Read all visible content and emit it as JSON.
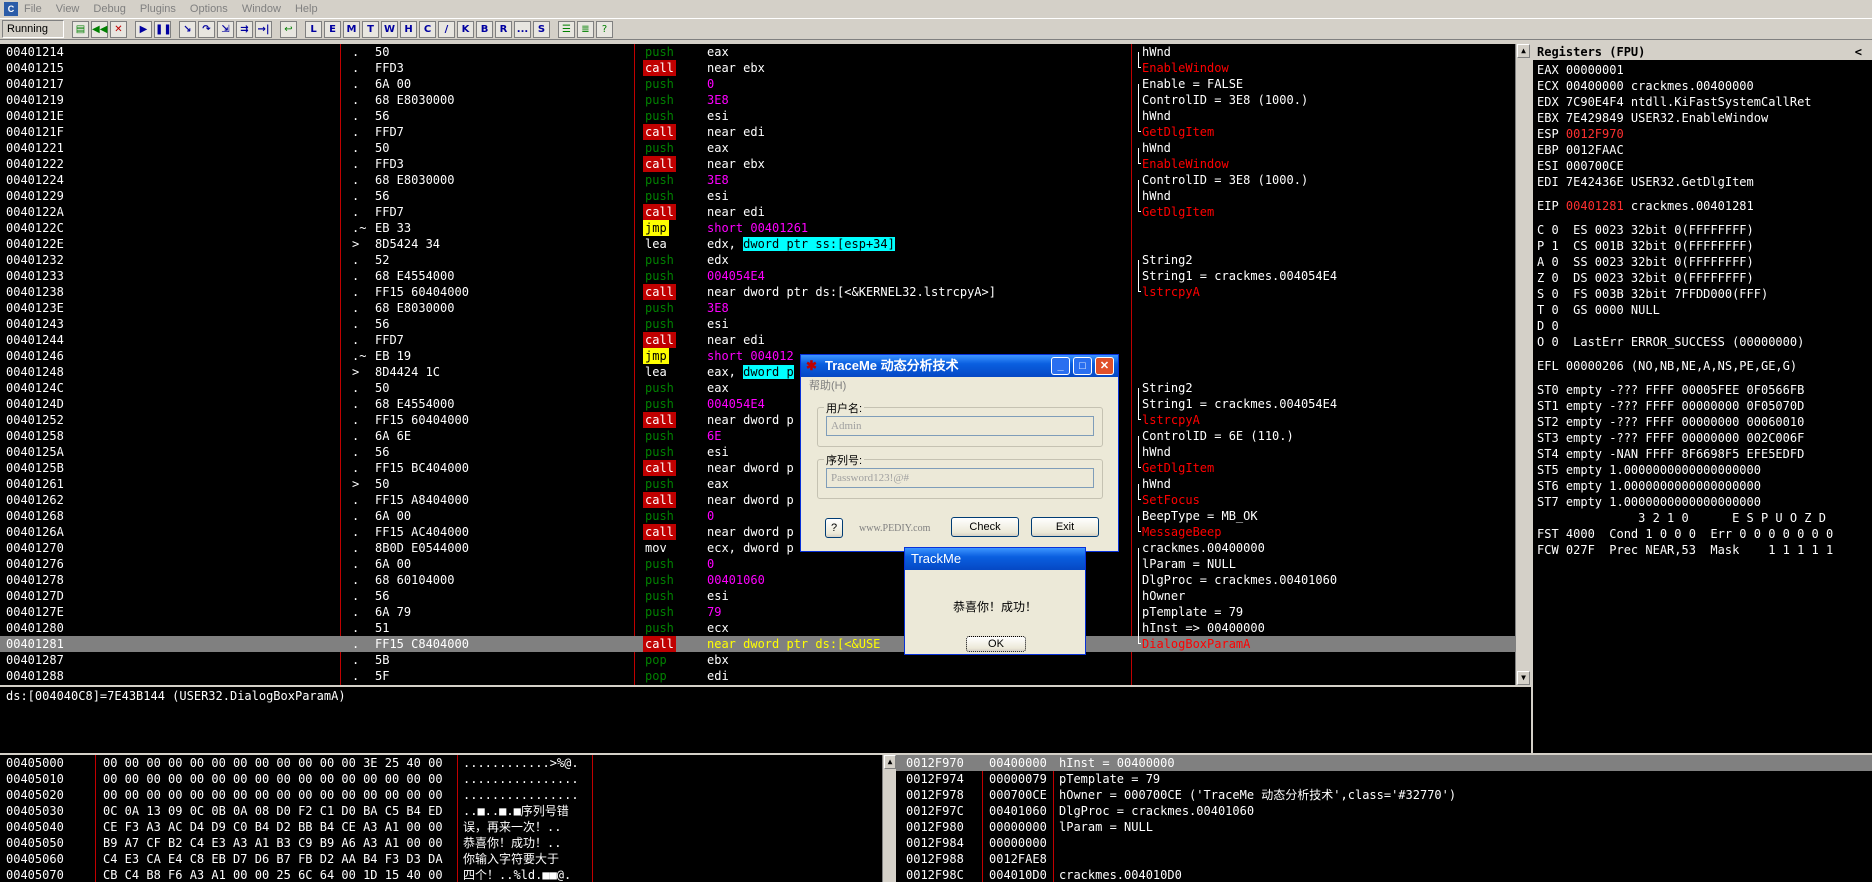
{
  "menubar": [
    "File",
    "View",
    "Debug",
    "Plugins",
    "Options",
    "Window",
    "Help"
  ],
  "toolbar": {
    "status": "Running",
    "buttons": [
      "L",
      "E",
      "M",
      "T",
      "W",
      "H",
      "C",
      "/",
      "K",
      "B",
      "R",
      "...",
      "S"
    ]
  },
  "cpu": [
    {
      "a": "00401214",
      "d": ".",
      "h": "50",
      "m": "push",
      "o": "eax",
      "c": "hWnd",
      "cc": ""
    },
    {
      "a": "00401215",
      "d": ".",
      "h": "FFD3",
      "m": "call",
      "o": "near ebx",
      "c": "EnableWindow",
      "cc": "fn"
    },
    {
      "a": "00401217",
      "d": ".",
      "h": "6A 00",
      "m": "push",
      "o": "0",
      "oc": "num",
      "c": "Enable = FALSE",
      "cc": ""
    },
    {
      "a": "00401219",
      "d": ".",
      "h": "68 E8030000",
      "m": "push",
      "o": "3E8",
      "oc": "num",
      "c": "ControlID = 3E8 (1000.)",
      "cc": ""
    },
    {
      "a": "0040121E",
      "d": ".",
      "h": "56",
      "m": "push",
      "o": "esi",
      "c": "hWnd",
      "cc": ""
    },
    {
      "a": "0040121F",
      "d": ".",
      "h": "FFD7",
      "m": "call",
      "o": "near edi",
      "c": "GetDlgItem",
      "cc": "fn"
    },
    {
      "a": "00401221",
      "d": ".",
      "h": "50",
      "m": "push",
      "o": "eax",
      "c": "hWnd",
      "cc": ""
    },
    {
      "a": "00401222",
      "d": ".",
      "h": "FFD3",
      "m": "call",
      "o": "near ebx",
      "c": "EnableWindow",
      "cc": "fn"
    },
    {
      "a": "00401224",
      "d": ".",
      "h": "68 E8030000",
      "m": "push",
      "o": "3E8",
      "oc": "num",
      "c": "ControlID = 3E8 (1000.)",
      "cc": ""
    },
    {
      "a": "00401229",
      "d": ".",
      "h": "56",
      "m": "push",
      "o": "esi",
      "c": "hWnd",
      "cc": ""
    },
    {
      "a": "0040122A",
      "d": ".",
      "h": "FFD7",
      "m": "call",
      "o": "near edi",
      "c": "GetDlgItem",
      "cc": "fn"
    },
    {
      "a": "0040122C",
      "d": ".~",
      "h": "EB 33",
      "m": "jmp",
      "o": "short 00401261",
      "oc": "num",
      "c": "",
      "cc": ""
    },
    {
      "a": "0040122E",
      "d": ">",
      "h": "8D5424 34",
      "m": "lea",
      "o": "edx, ",
      "o2": "dword ptr ss:[esp+34]",
      "c": "",
      "cc": ""
    },
    {
      "a": "00401232",
      "d": ".",
      "h": "52",
      "m": "push",
      "o": "edx",
      "c": "String2",
      "cc": ""
    },
    {
      "a": "00401233",
      "d": ".",
      "h": "68 E4554000",
      "m": "push",
      "o": "004054E4",
      "oc": "num",
      "c": "String1 = crackmes.004054E4",
      "cc": ""
    },
    {
      "a": "00401238",
      "d": ".",
      "h": "FF15 60404000",
      "m": "call",
      "o": "near dword ptr ds:[<&KERNEL32.lstrcpyA>]",
      "c": "lstrcpyA",
      "cc": "fn"
    },
    {
      "a": "0040123E",
      "d": ".",
      "h": "68 E8030000",
      "m": "push",
      "o": "3E8",
      "oc": "num",
      "c": "",
      "cc": ""
    },
    {
      "a": "00401243",
      "d": ".",
      "h": "56",
      "m": "push",
      "o": "esi",
      "c": "",
      "cc": ""
    },
    {
      "a": "00401244",
      "d": ".",
      "h": "FFD7",
      "m": "call",
      "o": "near edi",
      "c": "",
      "cc": ""
    },
    {
      "a": "00401246",
      "d": ".~",
      "h": "EB 19",
      "m": "jmp",
      "o": "short 004012",
      "oc": "num",
      "c": "",
      "cc": ""
    },
    {
      "a": "00401248",
      "d": ">",
      "h": "8D4424 1C",
      "m": "lea",
      "o": "eax, ",
      "o2": "dword p",
      "c": "",
      "cc": ""
    },
    {
      "a": "0040124C",
      "d": ".",
      "h": "50",
      "m": "push",
      "o": "eax",
      "c": "String2",
      "cc": ""
    },
    {
      "a": "0040124D",
      "d": ".",
      "h": "68 E4554000",
      "m": "push",
      "o": "004054E4",
      "oc": "num",
      "c": "String1 = crackmes.004054E4",
      "cc": ""
    },
    {
      "a": "00401252",
      "d": ".",
      "h": "FF15 60404000",
      "m": "call",
      "o": "near dword p",
      "c": "lstrcpyA",
      "cc": "fn"
    },
    {
      "a": "00401258",
      "d": ".",
      "h": "6A 6E",
      "m": "push",
      "o": "6E",
      "oc": "num",
      "c": "ControlID = 6E (110.)",
      "cc": ""
    },
    {
      "a": "0040125A",
      "d": ".",
      "h": "56",
      "m": "push",
      "o": "esi",
      "c": "hWnd",
      "cc": ""
    },
    {
      "a": "0040125B",
      "d": ".",
      "h": "FF15 BC404000",
      "m": "call",
      "o": "near dword p",
      "c": "GetDlgItem",
      "cc": "fn"
    },
    {
      "a": "00401261",
      "d": ">",
      "h": "50",
      "m": "push",
      "o": "eax",
      "c": "hWnd",
      "cc": ""
    },
    {
      "a": "00401262",
      "d": ".",
      "h": "FF15 A8404000",
      "m": "call",
      "o": "near dword p",
      "c": "SetFocus",
      "cc": "fn"
    },
    {
      "a": "00401268",
      "d": ".",
      "h": "6A 00",
      "m": "push",
      "o": "0",
      "oc": "num",
      "c": "BeepType = MB_OK",
      "cc": ""
    },
    {
      "a": "0040126A",
      "d": ".",
      "h": "FF15 AC404000",
      "m": "call",
      "o": "near dword p",
      "c": "MessageBeep",
      "cc": "fn"
    },
    {
      "a": "00401270",
      "d": ".",
      "h": "8B0D E0544000",
      "m": "mov",
      "o": "ecx, dword p",
      "c": "crackmes.00400000",
      "cc": ""
    },
    {
      "a": "00401276",
      "d": ".",
      "h": "6A 00",
      "m": "push",
      "o": "0",
      "oc": "num",
      "c": "lParam = NULL",
      "cc": ""
    },
    {
      "a": "00401278",
      "d": ".",
      "h": "68 60104000",
      "m": "push",
      "o": "00401060",
      "oc": "num",
      "c": "DlgProc = crackmes.00401060",
      "cc": ""
    },
    {
      "a": "0040127D",
      "d": ".",
      "h": "56",
      "m": "push",
      "o": "esi",
      "c": "hOwner",
      "cc": ""
    },
    {
      "a": "0040127E",
      "d": ".",
      "h": "6A 79",
      "m": "push",
      "o": "79",
      "oc": "num",
      "c": "pTemplate = 79",
      "cc": ""
    },
    {
      "a": "00401280",
      "d": ".",
      "h": "51",
      "m": "push",
      "o": "ecx",
      "c": "hInst => 00400000",
      "cc": ""
    },
    {
      "a": "00401281",
      "d": ".",
      "h": "FF15 C8404000",
      "m": "call",
      "o": "near dword ptr ds:[<&USE",
      "c": "DialogBoxParamA",
      "cc": "fn",
      "sel": true
    },
    {
      "a": "00401287",
      "d": ".",
      "h": "5B",
      "m": "pop",
      "o": "ebx",
      "c": "",
      "cc": ""
    },
    {
      "a": "00401288",
      "d": ".",
      "h": "5F",
      "m": "pop",
      "o": "edi",
      "c": "",
      "cc": ""
    }
  ],
  "info": "ds:[004040C8]=7E43B144 (USER32.DialogBoxParamA)",
  "registers": {
    "title": "Registers (FPU)",
    "collapse": "<",
    "gpr": [
      {
        "t": "EAX 00000001"
      },
      {
        "t": "ECX 00400000 crackmes.00400000"
      },
      {
        "t": "EDX 7C90E4F4 ntdll.KiFastSystemCallRet"
      },
      {
        "t": "EBX 7E429849 USER32.EnableWindow"
      },
      {
        "t": "ESP ",
        "v": "0012F970",
        "red": true
      },
      {
        "t": "EBP 0012FAAC"
      },
      {
        "t": "ESI 000700CE"
      },
      {
        "t": "EDI 7E42436E USER32.GetDlgItem"
      }
    ],
    "eip": {
      "t": "EIP ",
      "v": "00401281",
      "rest": " crackmes.00401281"
    },
    "flags": [
      "C 0  ES 0023 32bit 0(FFFFFFFF)",
      "P 1  CS 001B 32bit 0(FFFFFFFF)",
      "A 0  SS 0023 32bit 0(FFFFFFFF)",
      "Z 0  DS 0023 32bit 0(FFFFFFFF)",
      "S 0  FS 003B 32bit 7FFDD000(FFF)",
      "T 0  GS 0000 NULL",
      "D 0",
      "O 0  LastErr ERROR_SUCCESS (00000000)"
    ],
    "efl": "EFL 00000206 (NO,NB,NE,A,NS,PE,GE,G)",
    "fpu": [
      "ST0 empty -??? FFFF 00005FEE 0F0566FB",
      "ST1 empty -??? FFFF 00000000 0F05070D",
      "ST2 empty -??? FFFF 00000000 00060010",
      "ST3 empty -??? FFFF 00000000 002C006F",
      "ST4 empty -NAN FFFF 8F6698F5 EFE5EDFD",
      "ST5 empty 1.0000000000000000000",
      "ST6 empty 1.0000000000000000000",
      "ST7 empty 1.0000000000000000000"
    ],
    "fpu_hdr": "              3 2 1 0      E S P U O Z D",
    "fst": "FST 4000  Cond 1 0 0 0  Err 0 0 0 0 0 0 0",
    "fcw": "FCW 027F  Prec NEAR,53  Mask    1 1 1 1 1"
  },
  "dump": [
    {
      "a": "00405000",
      "h": "00 00 00 00 00 00 00 00 00 00 00 00 3E 25 40 00",
      "s": "............>%@."
    },
    {
      "a": "00405010",
      "h": "00 00 00 00 00 00 00 00 00 00 00 00 00 00 00 00",
      "s": "................"
    },
    {
      "a": "00405020",
      "h": "00 00 00 00 00 00 00 00 00 00 00 00 00 00 00 00",
      "s": "................"
    },
    {
      "a": "00405030",
      "h": "0C 0A 13 09 0C 0B 0A 08 D0 F2 C1 D0 BA C5 B4 ED",
      "s": "..■..■.■序列号错"
    },
    {
      "a": "00405040",
      "h": "CE F3 A3 AC D4 D9 C0 B4 D2 BB B4 CE A3 A1 00 00",
      "s": "误，再来一次！.."
    },
    {
      "a": "00405050",
      "h": "B9 A7 CF B2 C4 E3 A3 A1 B3 C9 B9 A6 A3 A1 00 00",
      "s": "恭喜你！成功！.."
    },
    {
      "a": "00405060",
      "h": "C4 E3 CA E4 C8 EB D7 D6 B7 FB D2 AA B4 F3 D3 DA",
      "s": "你输入字符要大于"
    },
    {
      "a": "00405070",
      "h": "CB C4 B8 F6 A3 A1 00 00 25 6C 64 00 1D 15 40 00",
      "s": "四个！..%ld.■■@."
    }
  ],
  "stack": [
    {
      "a": "0012F970",
      "v": "00400000",
      "c": "hInst = 00400000",
      "sel": true
    },
    {
      "a": "0012F974",
      "v": "00000079",
      "c": "pTemplate = 79"
    },
    {
      "a": "0012F978",
      "v": "000700CE",
      "c": "hOwner = 000700CE ('TraceMe 动态分析技术',class='#32770')"
    },
    {
      "a": "0012F97C",
      "v": "00401060",
      "c": "DlgProc = crackmes.00401060"
    },
    {
      "a": "0012F980",
      "v": "00000000",
      "c": "lParam = NULL"
    },
    {
      "a": "0012F984",
      "v": "00000000",
      "c": ""
    },
    {
      "a": "0012F988",
      "v": "0012FAE8",
      "c": ""
    },
    {
      "a": "0012F98C",
      "v": "004010D0",
      "c": "crackmes.004010D0"
    }
  ],
  "traceme": {
    "title": "TraceMe 动态分析技术",
    "menu": "帮助(H)",
    "user_label": "用户名:",
    "user_value": "Admin",
    "serial_label": "序列号:",
    "serial_value": "Password123!@#",
    "help_btn": "?",
    "watermark": "www.PEDIY.com",
    "check_btn": "Check",
    "exit_btn": "Exit"
  },
  "msgbox": {
    "title": "TrackMe",
    "text": "恭喜你！成功！",
    "ok": "OK"
  }
}
